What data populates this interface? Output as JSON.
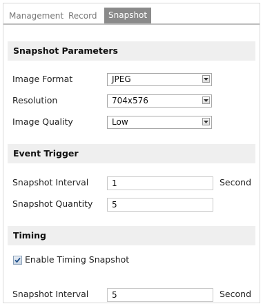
{
  "tabs": [
    {
      "label": "Management",
      "active": false
    },
    {
      "label": "Record",
      "active": false
    },
    {
      "label": "Snapshot",
      "active": true
    }
  ],
  "snapshot_parameters": {
    "heading": "Snapshot Parameters",
    "image_format": {
      "label": "Image Format",
      "value": "JPEG"
    },
    "resolution": {
      "label": "Resolution",
      "value": "704x576"
    },
    "image_quality": {
      "label": "Image Quality",
      "value": "Low"
    }
  },
  "event_trigger": {
    "heading": "Event Trigger",
    "snapshot_interval": {
      "label": "Snapshot Interval",
      "value": "1",
      "unit": "Second"
    },
    "snapshot_quantity": {
      "label": "Snapshot Quantity",
      "value": "5"
    }
  },
  "timing": {
    "heading": "Timing",
    "enable": {
      "label": "Enable Timing Snapshot",
      "checked": true
    },
    "snapshot_interval": {
      "label": "Snapshot Interval",
      "value": "5",
      "unit": "Second"
    }
  },
  "colors": {
    "active_tab_bg": "#8a8a8a",
    "section_bg": "#efefef",
    "tab_underline": "#bdbdbd"
  }
}
